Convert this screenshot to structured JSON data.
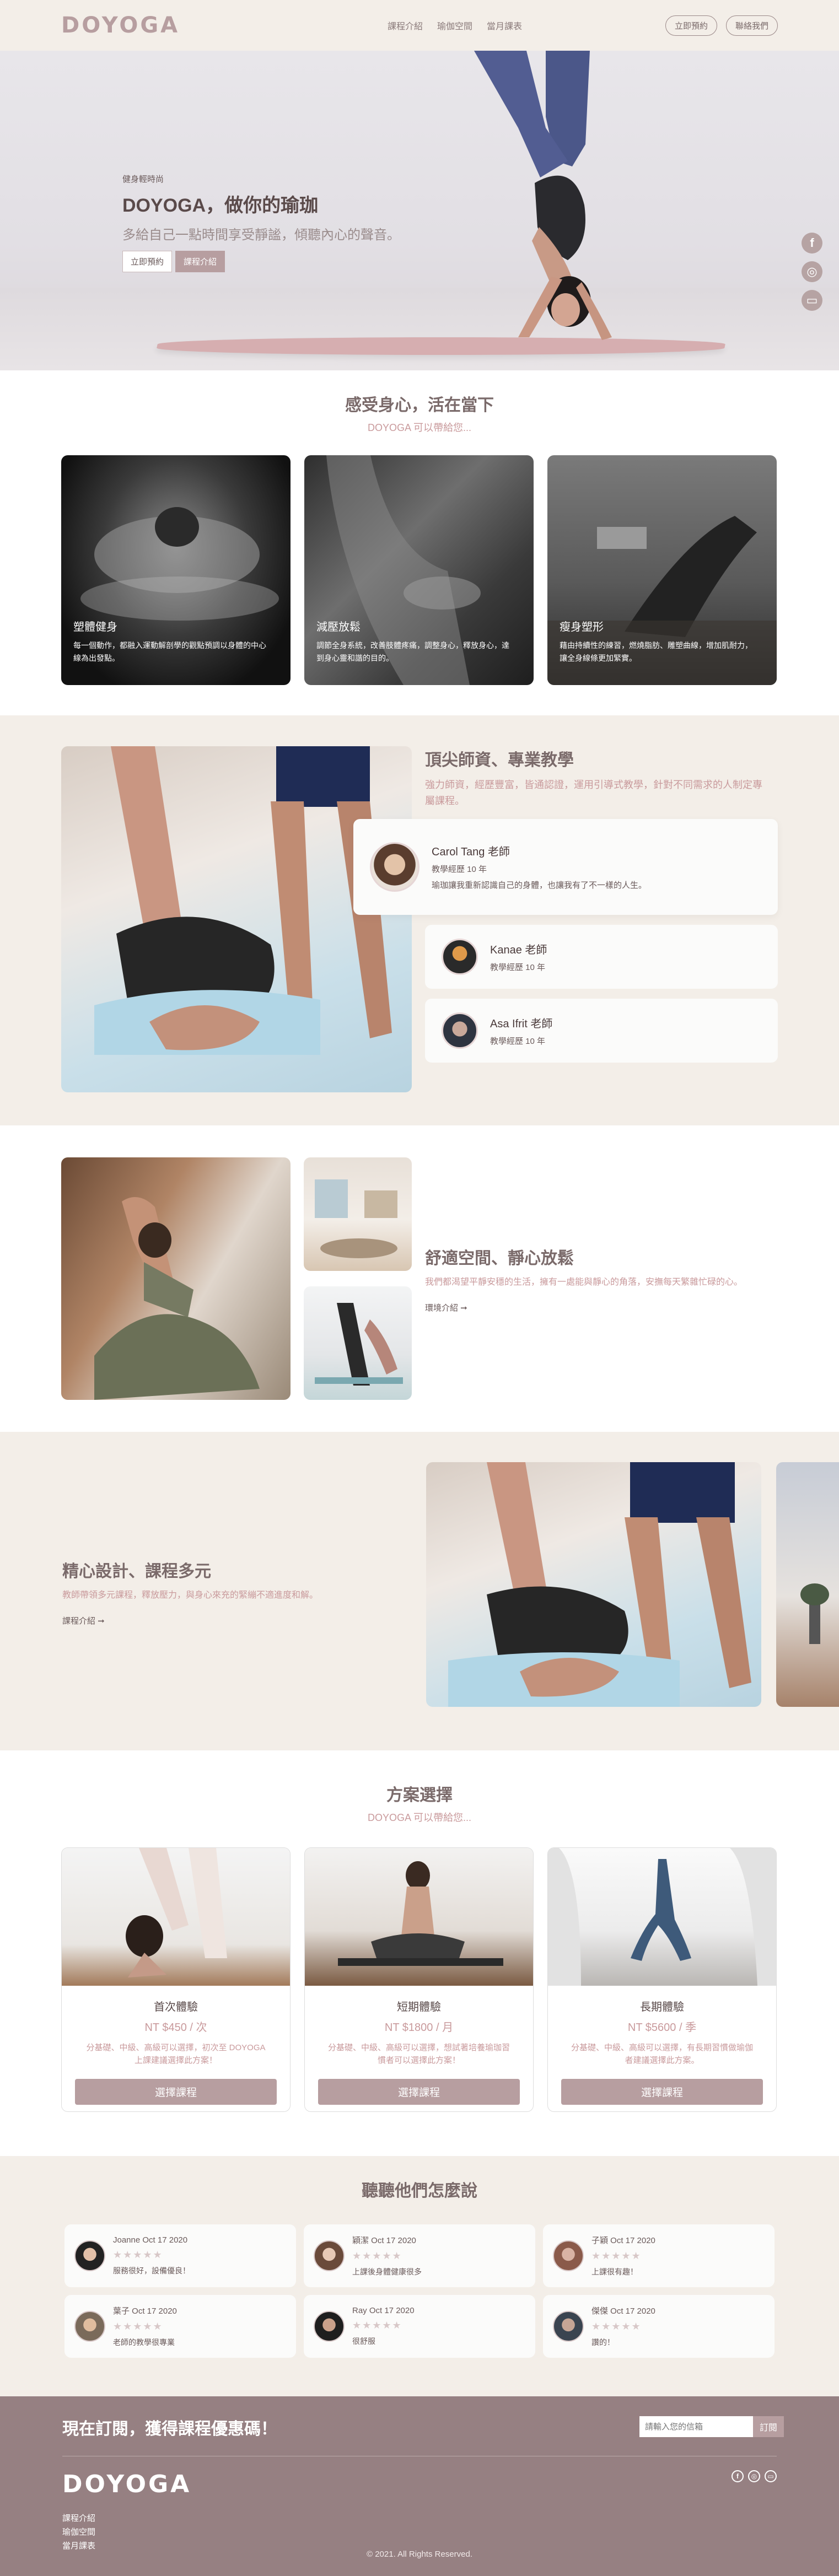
{
  "header": {
    "logo": "DOYOGA",
    "nav": [
      "課程介紹",
      "瑜伽空間",
      "當月課表"
    ],
    "buttons": [
      "立即預約",
      "聯絡我們"
    ]
  },
  "hero": {
    "pre": "健身輕時尚",
    "title": "DOYOGA，做你的瑜珈",
    "subtitle": "多給自己一點時間享受靜謐，傾聽內心的聲音。",
    "buttons": [
      "立即預約",
      "課程介紹"
    ],
    "social_icons": [
      "facebook-icon",
      "instagram-icon",
      "line-icon"
    ]
  },
  "features": {
    "title": "感受身心，活在當下",
    "subtitle": "DOYOGA 可以帶給您...",
    "cards": [
      {
        "title": "塑體健身",
        "text": "每一個動作，都融入運動解剖學的觀點預調以身體的中心線為出發點。"
      },
      {
        "title": "減壓放鬆",
        "text": "調節全身系統，改善肢體疼痛，調整身心，釋放身心，達到身心靈和諧的目的。"
      },
      {
        "title": "瘦身塑形",
        "text": "藉由持續性的練習，燃燒脂肪、雕塑曲線，增加肌耐力，讓全身線條更加緊實。"
      }
    ]
  },
  "teachers": {
    "title": "頂尖師資、專業教學",
    "desc": "強力師資，經歷豐富，皆通認證，運用引導式教學，針對不同需求的人制定專屬課程。",
    "list": [
      {
        "name": "Carol Tang 老師",
        "exp": "教學經歷 10 年",
        "quote": "瑜珈讓我重新認識自己的身體，也讓我有了不一樣的人生。"
      },
      {
        "name": "Kanae 老師",
        "exp": "教學經歷 10 年"
      },
      {
        "name": "Asa Ifrit 老師",
        "exp": "教學經歷 10 年"
      }
    ]
  },
  "space": {
    "title": "舒適空間、靜心放鬆",
    "desc": "我們都渴望平靜安穩的生活，擁有一處能與靜心的角落，安撫每天繁雜忙碌的心。",
    "more": "環境介紹 ➞"
  },
  "design": {
    "title": "精心設計、課程多元",
    "desc": "教師帶領多元課程，釋放壓力，與身心來充的緊繃不適進度和解。",
    "more": "課程介紹 ➞"
  },
  "plans": {
    "title": "方案選擇",
    "subtitle": "DOYOGA 可以帶給您...",
    "cards": [
      {
        "name": "首次體驗",
        "price": "NT $450 / 次",
        "desc": "分基礎、中級、高級可以選擇，初次至 DOYOGA 上課建議選擇此方案！",
        "button": "選擇課程"
      },
      {
        "name": "短期體驗",
        "price": "NT $1800 / 月",
        "desc": "分基礎、中級、高級可以選擇，想試著培養瑜珈習慣者可以選擇此方案！",
        "button": "選擇課程"
      },
      {
        "name": "長期體驗",
        "price": "NT $5600 / 季",
        "desc": "分基礎、中級、高級可以選擇，有長期習慣做瑜伽者建議選擇此方案。",
        "button": "選擇課程"
      }
    ]
  },
  "reviews": {
    "title": "聽聽他們怎麼說",
    "items": [
      {
        "name": "Joanne Oct 17 2020",
        "text": "服務很好，設備優良！"
      },
      {
        "name": "穎潔 Oct 17 2020",
        "text": "上課後身體健康很多"
      },
      {
        "name": "子穎 Oct 17 2020",
        "text": "上課很有趣！"
      },
      {
        "name": "葉子 Oct 17 2020",
        "text": "老師的教學很專業"
      },
      {
        "name": "Ray Oct 17 2020",
        "text": "很舒服"
      },
      {
        "name": "傑傑 Oct 17 2020",
        "text": "讚的！"
      }
    ],
    "stars": "★★★★★"
  },
  "footer": {
    "subscribe": "現在訂閱，獲得課程優惠碼！",
    "placeholder": "請輸入您的信箱",
    "submit": "訂閱",
    "logo": "DOYOGA",
    "links": [
      "課程介紹",
      "瑜伽空間",
      "當月課表"
    ],
    "icons": [
      "facebook-icon",
      "instagram-icon",
      "line-icon"
    ],
    "copyright": "© 2021. All Rights Reserved."
  },
  "colors": {
    "brand": "#b79ea0",
    "bg_beige": "#f3eee8",
    "footer": "#968082",
    "pink_text": "#c99a9c"
  }
}
